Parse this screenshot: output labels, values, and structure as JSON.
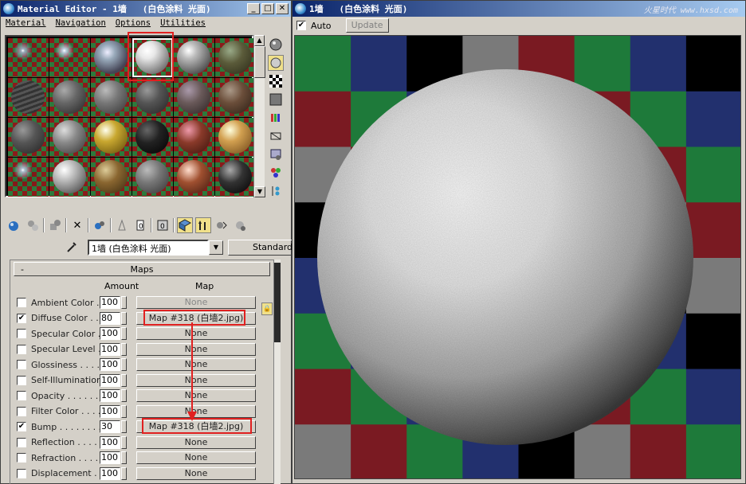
{
  "editor": {
    "title": "Material Editor - 1墙   (白色涂料 光面)",
    "menu": [
      "Material",
      "Navigation",
      "Options",
      "Utilities"
    ],
    "material_name": "1墙  (白色涂料 光面)",
    "material_type": "Standard",
    "rollout_title": "Maps",
    "col_amount": "Amount",
    "col_map": "Map",
    "maps": [
      {
        "label": "Ambient Color . .",
        "checked": false,
        "amount": "100",
        "map": "None",
        "dim": true
      },
      {
        "label": "Diffuse Color . . .",
        "checked": true,
        "amount": "80",
        "map": "Map #318 (白墙2.jpg)",
        "dim": false
      },
      {
        "label": "Specular Color . .",
        "checked": false,
        "amount": "100",
        "map": "None",
        "dim": false
      },
      {
        "label": "Specular Level  .",
        "checked": false,
        "amount": "100",
        "map": "None",
        "dim": false
      },
      {
        "label": "Glossiness . . . . .",
        "checked": false,
        "amount": "100",
        "map": "None",
        "dim": false
      },
      {
        "label": "Self-Illumination .",
        "checked": false,
        "amount": "100",
        "map": "None",
        "dim": false
      },
      {
        "label": "Opacity . . . . . . .",
        "checked": false,
        "amount": "100",
        "map": "None",
        "dim": false
      },
      {
        "label": "Filter Color  . . . .",
        "checked": false,
        "amount": "100",
        "map": "None",
        "dim": false
      },
      {
        "label": "Bump  . . . . . . . .",
        "checked": true,
        "amount": "30",
        "map": "Map #318 (白墙2.jpg)",
        "dim": false
      },
      {
        "label": "Reflection  . . . . .",
        "checked": false,
        "amount": "100",
        "map": "None",
        "dim": false
      },
      {
        "label": "Refraction  . . . . .",
        "checked": false,
        "amount": "100",
        "map": "None",
        "dim": false
      },
      {
        "label": "Displacement  . . .",
        "checked": false,
        "amount": "100",
        "map": "None",
        "dim": false
      }
    ]
  },
  "preview": {
    "title": "1墙   (白色涂料 光面)",
    "auto_label": "Auto",
    "auto_checked": true,
    "update_label": "Update",
    "watermark": "火星时代 www.hxsd.com"
  },
  "colors": {
    "titlebar": "#0a246a",
    "highlight": "#e02020",
    "checker_red": "#7a1a22",
    "checker_green": "#1e7a3a",
    "checker_blue": "#22306e",
    "checker_gray": "#7a7a7a"
  }
}
